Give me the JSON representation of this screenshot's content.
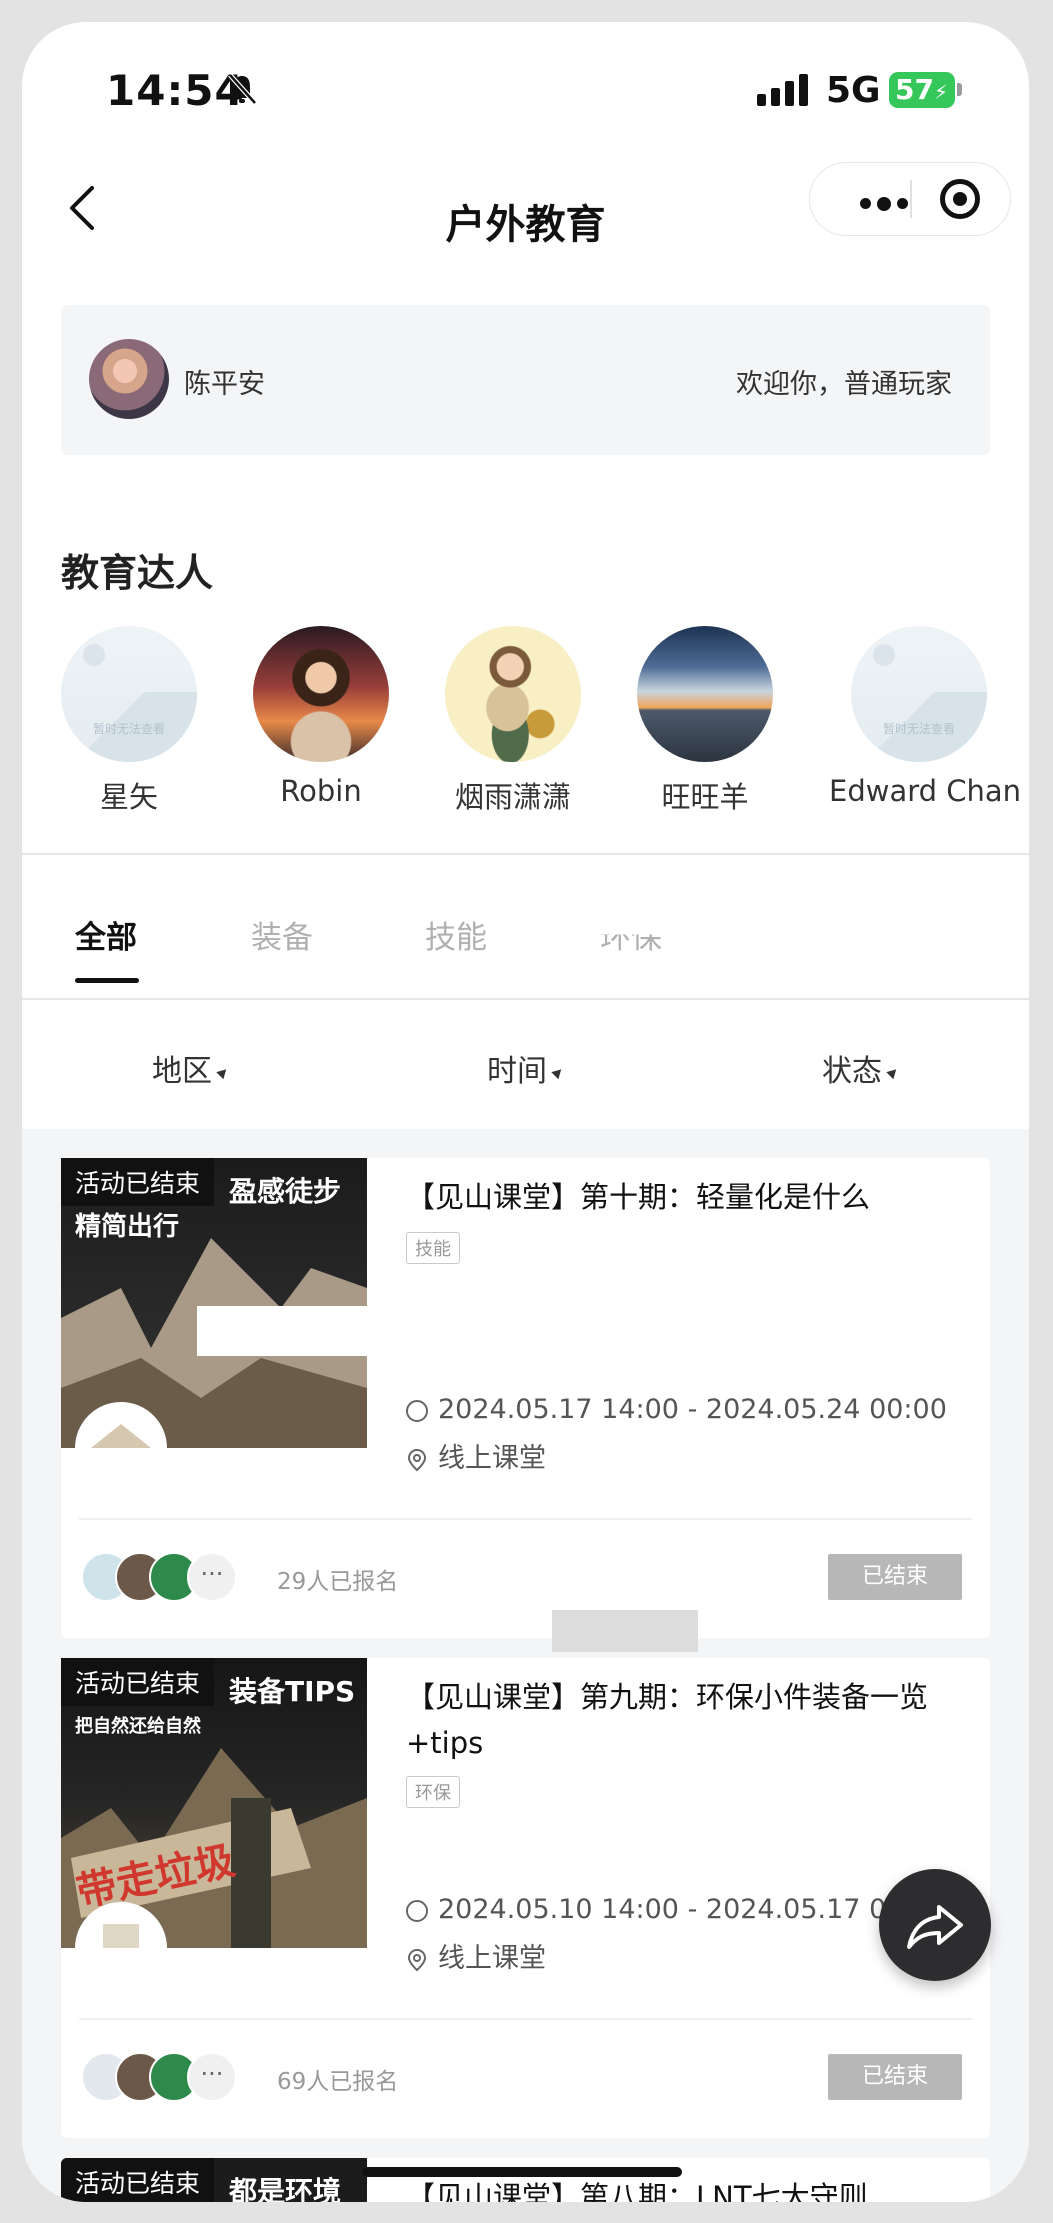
{
  "status_bar": {
    "time": "14:54",
    "network": "5G",
    "battery": "57"
  },
  "nav": {
    "title": "户外教育"
  },
  "user": {
    "name": "陈平安",
    "welcome": "欢迎你，普通玩家"
  },
  "experts": {
    "title": "教育达人",
    "placeholder_text": "暂时无法查看",
    "items": [
      {
        "name": "星矢"
      },
      {
        "name": "Robin"
      },
      {
        "name": "烟雨潇潇"
      },
      {
        "name": "旺旺羊"
      },
      {
        "name": "Edward Chan"
      }
    ]
  },
  "tabs": [
    {
      "label": "全部",
      "active": true
    },
    {
      "label": "装备",
      "active": false
    },
    {
      "label": "技能",
      "active": false
    },
    {
      "label": "环保",
      "active": false
    }
  ],
  "filters": [
    {
      "label": "地区"
    },
    {
      "label": "时间"
    },
    {
      "label": "状态"
    }
  ],
  "events": [
    {
      "badge": "活动已结束",
      "poster_text_1": "盈感徒步",
      "poster_text_2": "精简出行",
      "title": "【见山课堂】第十期：轻量化是什么",
      "tag": "技能",
      "time": "2024.05.17 14:00 - 2024.05.24 00:00",
      "location": "线上课堂",
      "signup": "29人已报名",
      "status": "已结束"
    },
    {
      "badge": "活动已结束",
      "poster_text_1": "装备TIPS",
      "poster_text_2": "把自然还给自然",
      "poster_text_3": "带走垃圾",
      "title": "【见山课堂】第九期：环保小件装备一览+tips",
      "tag": "环保",
      "time": "2024.05.10 14:00 - 2024.05.17 00:00",
      "location": "线上课堂",
      "signup": "69人已报名",
      "status": "已结束"
    },
    {
      "badge": "活动已结束",
      "poster_text_1": "都是环境",
      "title": "【见山课堂】第八期：LNT七大守则"
    }
  ],
  "more_label": "···",
  "colors": {
    "accent_dark": "#111111",
    "battery_green": "#35c759",
    "ended_gray": "#b7b7b7",
    "list_bg": "#f4f5f7"
  }
}
